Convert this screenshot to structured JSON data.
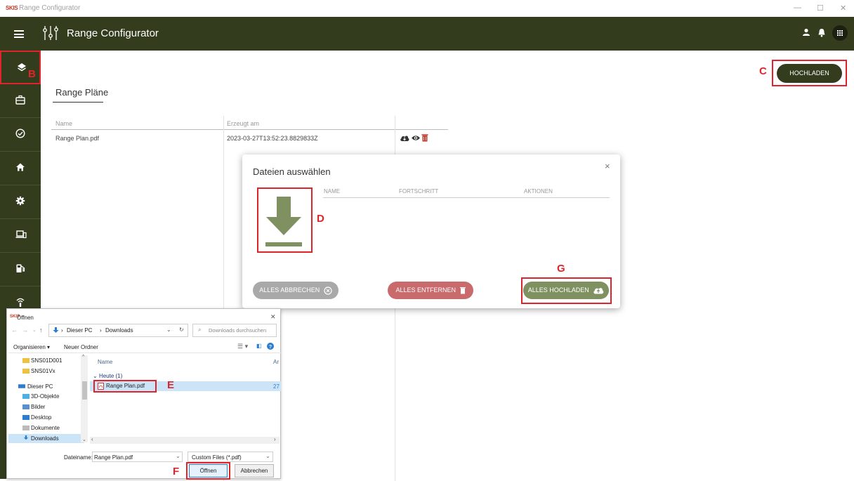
{
  "window": {
    "logo": "SKIS",
    "title": "Range Configurator",
    "minimize": "—",
    "maximize": "☐",
    "close": "✕"
  },
  "header": {
    "title": "Range Configurator"
  },
  "sidebar": {
    "items": [
      {
        "name": "layers"
      },
      {
        "name": "toolbox"
      },
      {
        "name": "check"
      },
      {
        "name": "home"
      },
      {
        "name": "settings"
      },
      {
        "name": "devices"
      },
      {
        "name": "fuel"
      },
      {
        "name": "antenna"
      }
    ]
  },
  "annotations": {
    "B": "B",
    "C": "C",
    "D": "D",
    "E": "E",
    "F": "F",
    "G": "G"
  },
  "main": {
    "title": "Range Pläne",
    "upload_label": "HOCHLADEN",
    "table": {
      "headers": [
        "Name",
        "Erzeugt am"
      ],
      "rows": [
        {
          "name": "Range Plan.pdf",
          "created": "2023-03-27T13:52:23.8829833Z"
        }
      ]
    }
  },
  "modal": {
    "title": "Dateien auswählen",
    "close": "×",
    "columns": [
      "NAME",
      "FORTSCHRITT",
      "AKTIONEN"
    ],
    "cancel_all": "ALLES ABBRECHEN",
    "remove_all": "ALLES ENTFERNEN",
    "upload_all": "ALLES HOCHLADEN",
    "colors": {
      "grey": "#a9a9a9",
      "red": "#c96a6c",
      "green": "#7f9160",
      "accent": "#7f9160"
    }
  },
  "file_dialog": {
    "logo": "SKIS",
    "title": "Öffnen",
    "close": "✕",
    "breadcrumb": [
      "Dieser PC",
      "Downloads"
    ],
    "search_placeholder": "Downloads durchsuchen",
    "organize": "Organisieren",
    "new_folder": "Neuer Ordner",
    "nav": [
      "SNS01D001",
      "SNS01Vx",
      "Dieser PC",
      "3D-Objekte",
      "Bilder",
      "Desktop",
      "Dokumente",
      "Downloads"
    ],
    "col_name": "Name",
    "col_cut": "Ar",
    "group": "Heute (1)",
    "file": "Range Plan.pdf",
    "file_cut": "27",
    "filename_label": "Dateiname:",
    "filename_value": "Range Plan.pdf",
    "filetype": "Custom Files (*.pdf)",
    "open": "Öffnen",
    "cancel": "Abbrechen"
  }
}
